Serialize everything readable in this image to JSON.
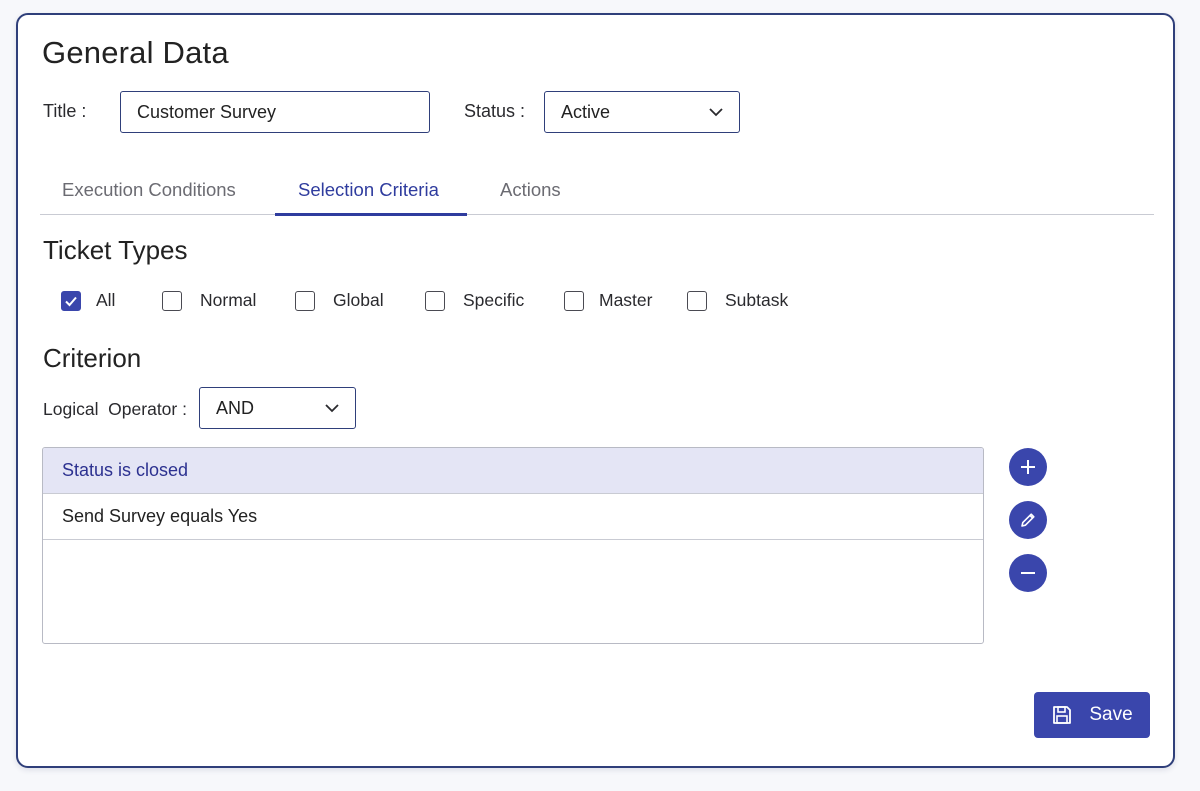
{
  "header": {
    "title": "General Data"
  },
  "form": {
    "title_label": "Title :",
    "title_value": "Customer Survey",
    "status_label": "Status :",
    "status_value": "Active"
  },
  "tabs": [
    {
      "label": "Execution Conditions",
      "active": false
    },
    {
      "label": "Selection Criteria",
      "active": true
    },
    {
      "label": "Actions",
      "active": false
    }
  ],
  "ticket_types": {
    "heading": "Ticket Types",
    "options": [
      {
        "label": "All",
        "checked": true
      },
      {
        "label": "Normal",
        "checked": false
      },
      {
        "label": "Global",
        "checked": false
      },
      {
        "label": "Specific",
        "checked": false
      },
      {
        "label": "Master",
        "checked": false
      },
      {
        "label": "Subtask",
        "checked": false
      }
    ]
  },
  "criterion": {
    "heading": "Criterion",
    "operator_label": "Logical  Operator :",
    "operator_value": "AND",
    "rows": [
      {
        "text": "Status is closed",
        "selected": true
      },
      {
        "text": "Send Survey equals Yes",
        "selected": false
      }
    ]
  },
  "side_buttons": {
    "add_icon": "plus-icon",
    "edit_icon": "pencil-icon",
    "remove_icon": "minus-icon"
  },
  "footer": {
    "save_label": "Save",
    "save_icon": "floppy-disk-icon"
  },
  "colors": {
    "accent": "#3a46ac",
    "border": "#2f3f7a",
    "selected_row": "#e4e5f5",
    "active_tab": "#2f3c9e"
  }
}
